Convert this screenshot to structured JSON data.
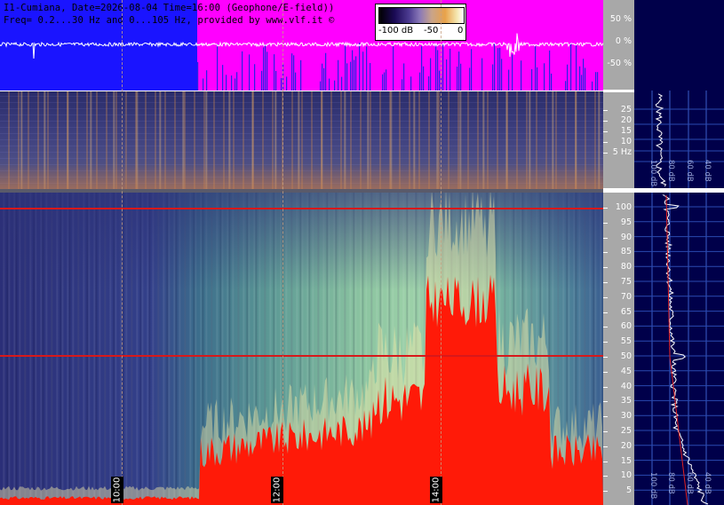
{
  "header": {
    "line1": "I1-Cumiana, Date=2026-08-04 Time=16:00 (Geophone/E-field))",
    "line2": "Freq= 0.2...30 Hz and 0...105 Hz, provided by www.vlf.it ©"
  },
  "colorbar": {
    "labels": [
      "-100 dB",
      "-50",
      "0"
    ]
  },
  "waveform_scale": {
    "labels": [
      "50 %",
      "0 %",
      "-50 %"
    ]
  },
  "low_scale": {
    "labels": [
      "25",
      "20",
      "15",
      "10",
      "5 Hz"
    ]
  },
  "high_scale": {
    "labels": [
      "100",
      "95",
      "90",
      "85",
      "80",
      "75",
      "70",
      "65",
      "60",
      "55",
      "50",
      "45",
      "40",
      "35",
      "30",
      "25",
      "20",
      "15",
      "10",
      "5"
    ]
  },
  "time_axis": {
    "labels": [
      "10:00",
      "12:00",
      "14:00"
    ]
  },
  "profile": {
    "labels": [
      "100 dB",
      "80 dB",
      "60 dB",
      "40 dB",
      "20 dB"
    ]
  },
  "colors": {
    "waveform_bg": "#ff00ff",
    "waveform_blue": "#1a14ff",
    "mains_line": "#d8181a",
    "profile_bg": "#00004a"
  }
}
